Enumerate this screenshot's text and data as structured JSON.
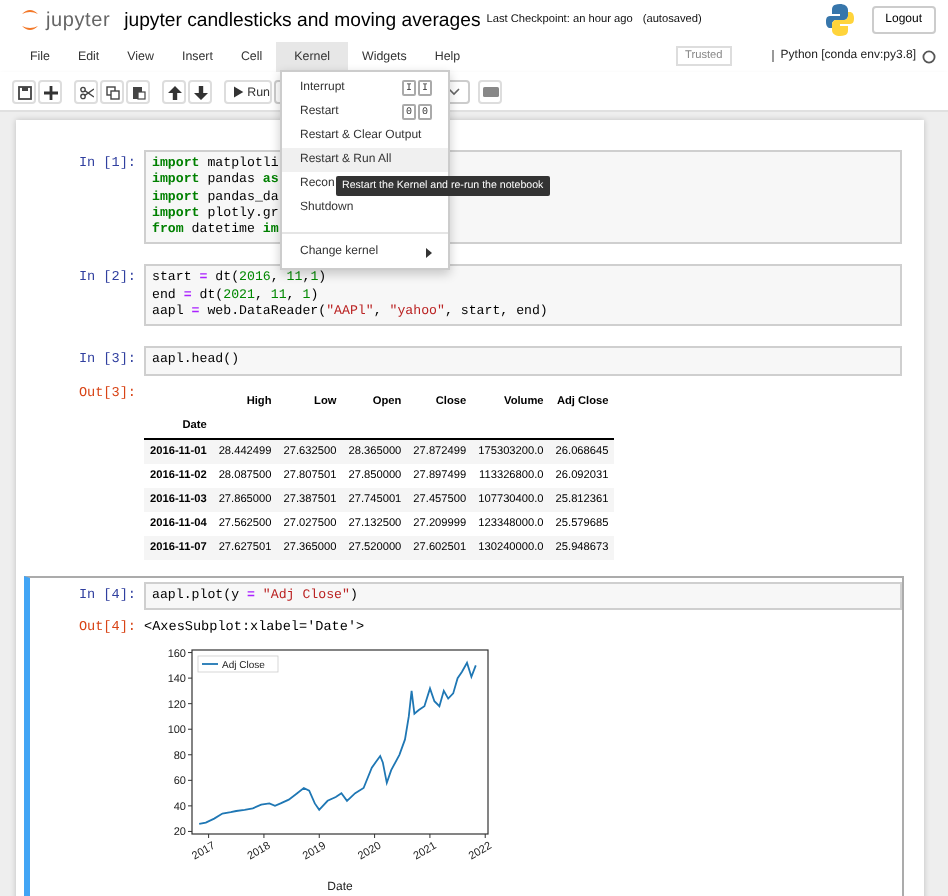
{
  "header": {
    "logo_text": "jupyter",
    "title": "jupyter candlesticks and moving averages",
    "checkpoint": "Last Checkpoint: an hour ago",
    "autosave": "(autosaved)",
    "logout": "Logout"
  },
  "menu": [
    {
      "label": "File",
      "selected": false
    },
    {
      "label": "Edit",
      "selected": false
    },
    {
      "label": "View",
      "selected": false
    },
    {
      "label": "Insert",
      "selected": false
    },
    {
      "label": "Cell",
      "selected": false
    },
    {
      "label": "Kernel",
      "selected": true
    },
    {
      "label": "Widgets",
      "selected": false
    },
    {
      "label": "Help",
      "selected": false
    }
  ],
  "trusted": "Trusted",
  "kernel_name": "Python [conda env:py3.8]",
  "toolbar": {
    "run_label": "Run"
  },
  "kernel_menu": {
    "items": [
      {
        "kind": "item",
        "label": "Interrupt",
        "shortcut": [
          "I",
          "I"
        ],
        "highlighted": false
      },
      {
        "kind": "item",
        "label": "Restart",
        "shortcut": [
          "0",
          "0"
        ],
        "highlighted": false
      },
      {
        "kind": "item",
        "label": "Restart & Clear Output",
        "highlighted": false
      },
      {
        "kind": "item",
        "label": "Restart & Run All",
        "highlighted": true
      },
      {
        "kind": "item",
        "label": "Recon",
        "highlighted": false
      },
      {
        "kind": "item",
        "label": "Shutdown",
        "highlighted": false
      },
      {
        "kind": "divider"
      },
      {
        "kind": "submenu",
        "label": "Change kernel",
        "highlighted": false
      }
    ],
    "tooltip": "Restart the Kernel and re-run the notebook"
  },
  "cells": [
    {
      "prompt": "In [1]:",
      "selected": false,
      "lines": [
        [
          {
            "kind": "kw",
            "text": "import"
          },
          {
            "kind": "plain",
            "text": " matplotli"
          }
        ],
        [
          {
            "kind": "kw",
            "text": "import"
          },
          {
            "kind": "plain",
            "text": " pandas "
          },
          {
            "kind": "kw",
            "text": "as"
          }
        ],
        [
          {
            "kind": "kw",
            "text": "import"
          },
          {
            "kind": "plain",
            "text": " pandas_da"
          }
        ],
        [
          {
            "kind": "kw",
            "text": "import"
          },
          {
            "kind": "plain",
            "text": " plotly.gr"
          }
        ],
        [
          {
            "kind": "kw",
            "text": "from"
          },
          {
            "kind": "plain",
            "text": " datetime "
          },
          {
            "kind": "kw",
            "text": "im"
          }
        ]
      ]
    },
    {
      "prompt": "In [2]:",
      "selected": false,
      "lines": [
        [
          {
            "kind": "plain",
            "text": "start "
          },
          {
            "kind": "op",
            "text": "="
          },
          {
            "kind": "plain",
            "text": " dt("
          },
          {
            "kind": "num",
            "text": "2016"
          },
          {
            "kind": "plain",
            "text": ", "
          },
          {
            "kind": "num",
            "text": "11"
          },
          {
            "kind": "plain",
            "text": ","
          },
          {
            "kind": "num",
            "text": "1"
          },
          {
            "kind": "plain",
            "text": ")"
          }
        ],
        [
          {
            "kind": "plain",
            "text": "end "
          },
          {
            "kind": "op",
            "text": "="
          },
          {
            "kind": "plain",
            "text": " dt("
          },
          {
            "kind": "num",
            "text": "2021"
          },
          {
            "kind": "plain",
            "text": ", "
          },
          {
            "kind": "num",
            "text": "11"
          },
          {
            "kind": "plain",
            "text": ", "
          },
          {
            "kind": "num",
            "text": "1"
          },
          {
            "kind": "plain",
            "text": ")"
          }
        ],
        [
          {
            "kind": "plain",
            "text": "aapl "
          },
          {
            "kind": "op",
            "text": "="
          },
          {
            "kind": "plain",
            "text": " web.DataReader("
          },
          {
            "kind": "str",
            "text": "\"AAPl\""
          },
          {
            "kind": "plain",
            "text": ", "
          },
          {
            "kind": "str",
            "text": "\"yahoo\""
          },
          {
            "kind": "plain",
            "text": ", start, end)"
          }
        ]
      ]
    },
    {
      "prompt": "In [3]:",
      "selected": false,
      "lines": [
        [
          {
            "kind": "plain",
            "text": "aapl.head()"
          }
        ]
      ],
      "output": {
        "kind": "table",
        "prompt": "Out[3]:",
        "index_name": "Date",
        "columns": [
          "High",
          "Low",
          "Open",
          "Close",
          "Volume",
          "Adj Close"
        ],
        "rows": [
          {
            "date": "2016-11-01",
            "values": [
              "28.442499",
              "27.632500",
              "28.365000",
              "27.872499",
              "175303200.0",
              "26.068645"
            ]
          },
          {
            "date": "2016-11-02",
            "values": [
              "28.087500",
              "27.807501",
              "27.850000",
              "27.897499",
              "113326800.0",
              "26.092031"
            ]
          },
          {
            "date": "2016-11-03",
            "values": [
              "27.865000",
              "27.387501",
              "27.745001",
              "27.457500",
              "107730400.0",
              "25.812361"
            ]
          },
          {
            "date": "2016-11-04",
            "values": [
              "27.562500",
              "27.027500",
              "27.132500",
              "27.209999",
              "123348000.0",
              "25.579685"
            ]
          },
          {
            "date": "2016-11-07",
            "values": [
              "27.627501",
              "27.365000",
              "27.520000",
              "27.602501",
              "130240000.0",
              "25.948673"
            ]
          }
        ]
      }
    },
    {
      "prompt": "In [4]:",
      "selected": true,
      "lines": [
        [
          {
            "kind": "plain",
            "text": "aapl.plot(y "
          },
          {
            "kind": "op",
            "text": "="
          },
          {
            "kind": "str",
            "text": " \"Adj Close\""
          },
          {
            "kind": "plain",
            "text": ")"
          }
        ]
      ],
      "output": {
        "kind": "chart",
        "prompt": "Out[4]:",
        "text": "<AxesSubplot:xlabel='Date'>",
        "chart_data": {
          "type": "line",
          "xlabel": "Date",
          "x": [
            2016.83,
            2016.95,
            2017.1,
            2017.25,
            2017.4,
            2017.5,
            2017.65,
            2017.8,
            2017.95,
            2018.1,
            2018.2,
            2018.3,
            2018.45,
            2018.6,
            2018.72,
            2018.82,
            2018.92,
            2019.0,
            2019.15,
            2019.3,
            2019.4,
            2019.5,
            2019.65,
            2019.8,
            2019.95,
            2020.1,
            2020.15,
            2020.22,
            2020.3,
            2020.45,
            2020.55,
            2020.62,
            2020.67,
            2020.72,
            2020.8,
            2020.9,
            2021.0,
            2021.08,
            2021.17,
            2021.25,
            2021.33,
            2021.42,
            2021.5,
            2021.58,
            2021.67,
            2021.75,
            2021.83
          ],
          "series": [
            {
              "name": "Adj Close",
              "color": "#1f77b4",
              "values": [
                26,
                27,
                30,
                34,
                35,
                36,
                37,
                38,
                41,
                42,
                40,
                42,
                45,
                50,
                54,
                52,
                42,
                37,
                44,
                47,
                50,
                44,
                50,
                54,
                70,
                79,
                74,
                58,
                68,
                80,
                92,
                110,
                130,
                112,
                115,
                118,
                132,
                122,
                118,
                130,
                124,
                128,
                140,
                145,
                152,
                141,
                150
              ]
            }
          ],
          "xlim": [
            2016.7,
            2022.05
          ],
          "ylim": [
            18,
            162
          ],
          "xticks": [
            {
              "value": 2017,
              "label": "2017"
            },
            {
              "value": 2018,
              "label": "2018"
            },
            {
              "value": 2019,
              "label": "2019"
            },
            {
              "value": 2020,
              "label": "2020"
            },
            {
              "value": 2021,
              "label": "2021"
            },
            {
              "value": 2022,
              "label": "2022"
            }
          ],
          "yticks": [
            20,
            40,
            60,
            80,
            100,
            120,
            140,
            160
          ]
        }
      }
    }
  ]
}
